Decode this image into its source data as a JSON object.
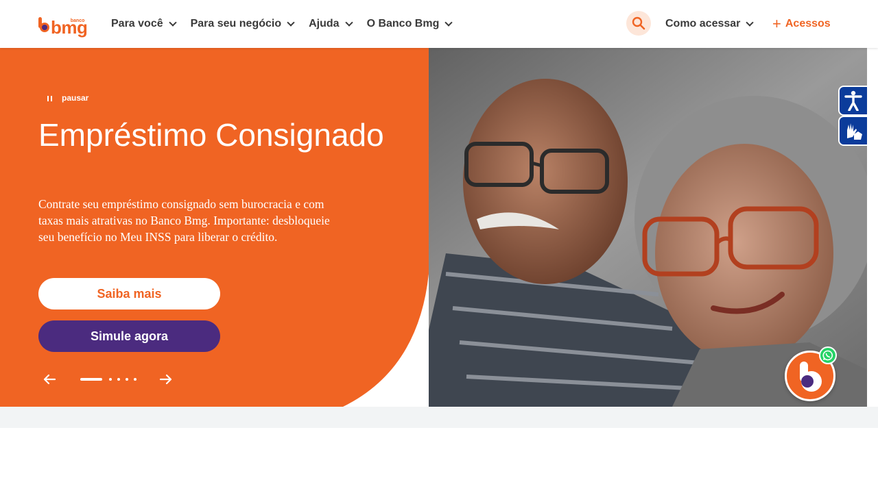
{
  "brand": {
    "name": "bmg",
    "small": "banco",
    "orange": "#f06423",
    "purple": "#4b2b7f"
  },
  "nav": {
    "items": [
      {
        "label": "Para você"
      },
      {
        "label": "Para seu negócio"
      },
      {
        "label": "Ajuda"
      },
      {
        "label": "O Banco Bmg"
      }
    ],
    "search_icon": "search-icon",
    "how_to_access": "Como acessar",
    "access": "Acessos"
  },
  "hero": {
    "pause_label": "pausar",
    "title": "Empréstimo Consignado",
    "description": "Contrate seu empréstimo consignado sem burocracia e com taxas mais atrativas no Banco Bmg. Importante: desbloqueie seu benefício no Meu INSS para liberar o crédito.",
    "primary_button": "Saiba mais",
    "secondary_button": "Simule agora",
    "slides_count": 5,
    "active_slide": 1
  },
  "accessibility": {
    "icons": [
      "accessibility-icon",
      "sign-language-icon"
    ]
  },
  "chat": {
    "icons": [
      "bmg-chat-icon",
      "whatsapp-icon"
    ]
  }
}
